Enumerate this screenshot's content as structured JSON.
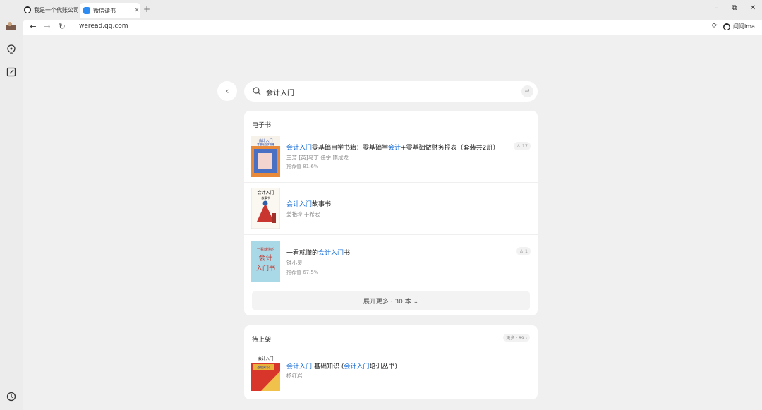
{
  "browser": {
    "tabs": [
      {
        "title": "我是一个代账公司"
      },
      {
        "title": "微信读书"
      }
    ],
    "new_tab": "+",
    "url": "weread.qq.com",
    "ima_label": "问问ima",
    "window_controls": {
      "minimize": "–",
      "restore": "⧉",
      "close": "✕"
    }
  },
  "search": {
    "query": "会计入门"
  },
  "ebooks": {
    "section_title": "电子书",
    "books": [
      {
        "title_parts": [
          {
            "text": "会计入门",
            "hl": true
          },
          {
            "text": "零基础自学书籍：零基础学",
            "hl": false
          },
          {
            "text": "会计",
            "hl": true
          },
          {
            "text": "+零基础做财务报表（套装共2册）",
            "hl": false
          }
        ],
        "authors": "王芳 [英]马丁 任宁 隋成龙",
        "recommend": "推荐值 81.6%",
        "readers": "17"
      },
      {
        "title_parts": [
          {
            "text": "会计入门",
            "hl": true
          },
          {
            "text": "故事书",
            "hl": false
          }
        ],
        "authors": "姜艳玲 于希宏",
        "recommend": "",
        "readers": ""
      },
      {
        "title_parts": [
          {
            "text": "一看就懂的",
            "hl": false
          },
          {
            "text": "会计入门",
            "hl": true
          },
          {
            "text": "书",
            "hl": false
          }
        ],
        "authors": "钟小灵",
        "recommend": "推荐值 67.5%",
        "readers": "1"
      }
    ],
    "expand_label": "展开更多 · 30 本 ⌄"
  },
  "pending": {
    "section_title": "待上架",
    "more_label": "更多 · 89 ›",
    "books": [
      {
        "title_parts": [
          {
            "text": "会计入门",
            "hl": true
          },
          {
            "text": ":基础知识 (",
            "hl": false
          },
          {
            "text": "会计入门",
            "hl": true
          },
          {
            "text": "培训丛书)",
            "hl": false
          }
        ],
        "authors": "杨红岩"
      }
    ]
  },
  "covers": {
    "book1": {
      "line1": "会计入门",
      "line2": "零基础自学书籍"
    },
    "book2": {
      "line1": "会计入门",
      "line2": "故事书"
    },
    "book3": {
      "line1": "一看就懂的",
      "line2": "会计",
      "line3": "入门书"
    },
    "book4": {
      "line1": "会计入门",
      "line2": "基础知识"
    }
  },
  "colors": {
    "highlight": "#1a6fd6",
    "background": "#f0f0f0",
    "card": "#ffffff"
  }
}
